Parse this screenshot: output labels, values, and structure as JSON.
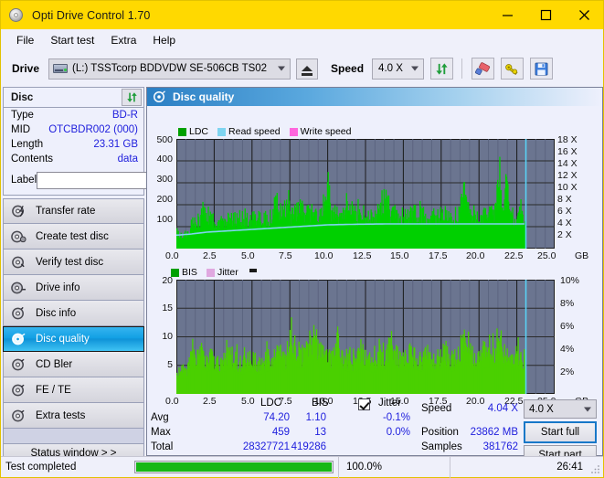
{
  "window": {
    "title": "Opti Drive Control 1.70",
    "icon": "disc-icon",
    "minimize": "—",
    "maximize": "□",
    "close": "✕"
  },
  "menubar": {
    "items": [
      {
        "label": "File"
      },
      {
        "label": "Start test"
      },
      {
        "label": "Extra"
      },
      {
        "label": "Help"
      }
    ]
  },
  "toolbar": {
    "drive_label": "Drive",
    "drive_value": "(L:)  TSSTcorp BDDVDW SE-506CB TS02",
    "eject_title": "eject-button",
    "speed_label": "Speed",
    "speed_value": "4.0 X",
    "icons": [
      "refresh-icon",
      "eraser-icon",
      "bitsetting-icon",
      "save-icon"
    ]
  },
  "sidebar": {
    "disc_panel": {
      "title": "Disc",
      "refresh_icon": "refresh-icon",
      "rows": [
        {
          "key": "Type",
          "value": "BD-R"
        },
        {
          "key": "MID",
          "value": "OTCBDR002 (000)"
        },
        {
          "key": "Length",
          "value": "23.31 GB"
        },
        {
          "key": "Contents",
          "value": "data"
        }
      ],
      "label_key": "Label",
      "label_value": "",
      "label_placeholder": "",
      "label_button_icon": "disc-icon"
    },
    "nav_items": [
      {
        "label": "Transfer rate",
        "icon": "disc-test-icon",
        "active": false
      },
      {
        "label": "Create test disc",
        "icon": "disc-burn-icon",
        "active": false
      },
      {
        "label": "Verify test disc",
        "icon": "disc-verify-icon",
        "active": false
      },
      {
        "label": "Drive info",
        "icon": "drive-info-icon",
        "active": false
      },
      {
        "label": "Disc info",
        "icon": "disc-info-icon",
        "active": false
      },
      {
        "label": "Disc quality",
        "icon": "disc-quality-icon",
        "active": true
      },
      {
        "label": "CD Bler",
        "icon": "disc-bler-icon",
        "active": false
      },
      {
        "label": "FE / TE",
        "icon": "disc-fete-icon",
        "active": false
      },
      {
        "label": "Extra tests",
        "icon": "disc-extra-icon",
        "active": false
      }
    ],
    "status_window_button": "Status window > >"
  },
  "main": {
    "header_title": "Disc quality",
    "header_icon": "disc-quality-icon"
  },
  "stats": {
    "col_ldc": "LDC",
    "col_bis": "BIS",
    "jitter_label": "Jitter",
    "jitter_checked": true,
    "rows": [
      {
        "name": "Avg",
        "ldc": "74.20",
        "bis": "1.10",
        "jitter": "-0.1%"
      },
      {
        "name": "Max",
        "ldc": "459",
        "bis": "13",
        "jitter": "0.0%"
      },
      {
        "name": "Total",
        "ldc": "28327721",
        "bis": "419286",
        "jitter": ""
      }
    ],
    "speed_label": "Speed",
    "speed_value": "4.04 X",
    "position_label": "Position",
    "position_value": "23862 MB",
    "samples_label": "Samples",
    "samples_value": "381762",
    "speed_select": "4.0 X",
    "start_full": "Start full",
    "start_part": "Start part"
  },
  "statusbar": {
    "text": "Test completed",
    "percent": "100.0%",
    "progress": 100,
    "time": "26:41"
  },
  "colors": {
    "titlebar": "#ffd900",
    "accent_blue": "#2020dd",
    "plot_bg": "#6b7590",
    "ldc_green": "#00d000",
    "bis_green": "#3ad000",
    "jitter_pink": "#e0a8e0",
    "read_speed": "#7fd4f0",
    "write_speed": "#ff66dd",
    "progress_green": "#16b816",
    "active_nav": "#12a0e4"
  },
  "chart_data": [
    {
      "id": "ldc-chart",
      "type": "area",
      "title": "",
      "xlabel": "GB",
      "ylabel": "",
      "xlim": [
        0,
        25
      ],
      "xticks": [
        "0.0",
        "2.5",
        "5.0",
        "7.5",
        "10.0",
        "12.5",
        "15.0",
        "17.5",
        "20.0",
        "22.5",
        "25.0"
      ],
      "ylim": [
        0,
        500
      ],
      "yticks": [
        "100",
        "200",
        "300",
        "400",
        "500"
      ],
      "y2lim": [
        0,
        18
      ],
      "y2ticks": [
        "2 X",
        "4 X",
        "6 X",
        "8 X",
        "10 X",
        "12 X",
        "14 X",
        "16 X",
        "18 X"
      ],
      "grid": true,
      "legend": [
        {
          "label": "LDC",
          "color": "#00a000"
        },
        {
          "label": "Read speed",
          "color": "#7fd4f0"
        },
        {
          "label": "Write speed",
          "color": "#ff66dd"
        }
      ],
      "series": [
        {
          "name": "LDC",
          "color": "#00d000",
          "x": [
            0.0,
            0.3,
            0.6,
            0.9,
            1.0,
            1.3,
            1.6,
            1.9,
            2.0,
            2.3,
            2.6,
            3.0,
            3.4,
            3.8,
            4.2,
            4.6,
            5.0,
            5.4,
            5.8,
            6.2,
            6.6,
            7.0,
            7.4,
            7.5,
            7.8,
            8.2,
            8.6,
            9.0,
            9.4,
            9.8,
            10.0,
            10.2,
            10.6,
            11.0,
            11.4,
            11.8,
            12.2,
            12.6,
            13.0,
            13.4,
            13.8,
            14.2,
            14.6,
            15.0,
            15.4,
            15.8,
            16.2,
            16.6,
            17.0,
            17.4,
            17.8,
            18.2,
            18.6,
            19.0,
            19.4,
            19.8,
            20.2,
            20.6,
            21.0,
            21.4,
            21.6,
            21.8,
            22.0,
            22.4,
            22.8,
            23.1
          ],
          "values": [
            95,
            70,
            80,
            95,
            160,
            150,
            160,
            235,
            165,
            155,
            160,
            150,
            165,
            160,
            170,
            165,
            160,
            175,
            160,
            175,
            250,
            165,
            290,
            180,
            200,
            225,
            200,
            195,
            185,
            255,
            425,
            195,
            190,
            205,
            280,
            175,
            190,
            180,
            175,
            195,
            330,
            185,
            185,
            180,
            190,
            200,
            185,
            175,
            180,
            190,
            185,
            175,
            185,
            300,
            185,
            195,
            190,
            185,
            190,
            455,
            200,
            440,
            195,
            185,
            185,
            180
          ]
        },
        {
          "name": "Read speed",
          "color": "#7fd4f0",
          "x": [
            0.0,
            1.0,
            2.0,
            4.0,
            6.0,
            8.0,
            10.0,
            12.0,
            14.0,
            16.0,
            18.0,
            20.0,
            22.0,
            23.1
          ],
          "values": [
            2.2,
            2.4,
            2.7,
            3.0,
            3.3,
            3.6,
            3.9,
            4.0,
            4.05,
            4.05,
            4.05,
            4.05,
            4.05,
            4.05
          ]
        }
      ],
      "cursor_x": 23.1
    },
    {
      "id": "bis-chart",
      "type": "area",
      "title": "",
      "xlabel": "GB",
      "ylabel": "",
      "xlim": [
        0,
        25
      ],
      "xticks": [
        "0.0",
        "2.5",
        "5.0",
        "7.5",
        "10.0",
        "12.5",
        "15.0",
        "17.5",
        "20.0",
        "22.5",
        "25.0"
      ],
      "ylim": [
        0,
        20
      ],
      "yticks": [
        "5",
        "10",
        "15",
        "20"
      ],
      "y2lim": [
        0,
        10
      ],
      "y2ticks": [
        "2%",
        "4%",
        "6%",
        "8%",
        "10%"
      ],
      "grid": true,
      "legend": [
        {
          "label": "BIS",
          "color": "#00a000"
        },
        {
          "label": "Jitter",
          "color": "#e0a8e0"
        }
      ],
      "series": [
        {
          "name": "BIS",
          "color": "#4ad000",
          "x": [
            0.0,
            0.4,
            0.8,
            1.0,
            1.2,
            1.6,
            2.0,
            2.4,
            2.8,
            3.2,
            3.6,
            4.0,
            4.4,
            4.8,
            5.2,
            5.6,
            6.0,
            6.4,
            6.8,
            7.2,
            7.6,
            8.0,
            8.4,
            8.8,
            9.2,
            9.4,
            9.8,
            10.2,
            10.6,
            11.0,
            11.4,
            11.8,
            12.2,
            12.6,
            13.0,
            13.4,
            13.8,
            14.2,
            14.6,
            15.0,
            15.4,
            15.8,
            16.2,
            16.6,
            17.0,
            17.4,
            17.8,
            18.2,
            18.6,
            19.0,
            19.4,
            19.8,
            20.2,
            20.6,
            21.0,
            21.4,
            21.6,
            21.8,
            22.2,
            22.6,
            23.1
          ],
          "values": [
            4.5,
            5.0,
            5.2,
            10.0,
            8.0,
            9.0,
            7.5,
            8.0,
            7.0,
            7.5,
            8.5,
            7.0,
            6.5,
            7.5,
            7.0,
            6.5,
            7.5,
            8.0,
            9.5,
            7.0,
            13.0,
            9.0,
            8.0,
            10.0,
            12.2,
            9.5,
            8.0,
            7.5,
            11.0,
            8.0,
            7.5,
            7.0,
            8.5,
            8.0,
            7.0,
            8.5,
            7.5,
            11.0,
            8.0,
            7.0,
            8.5,
            8.0,
            7.5,
            8.5,
            7.0,
            8.0,
            9.0,
            7.5,
            8.0,
            11.5,
            8.5,
            8.0,
            9.0,
            8.5,
            9.5,
            13.0,
            9.0,
            10.0,
            8.5,
            8.0,
            7.5
          ]
        }
      ],
      "cursor_x": 23.1
    }
  ]
}
